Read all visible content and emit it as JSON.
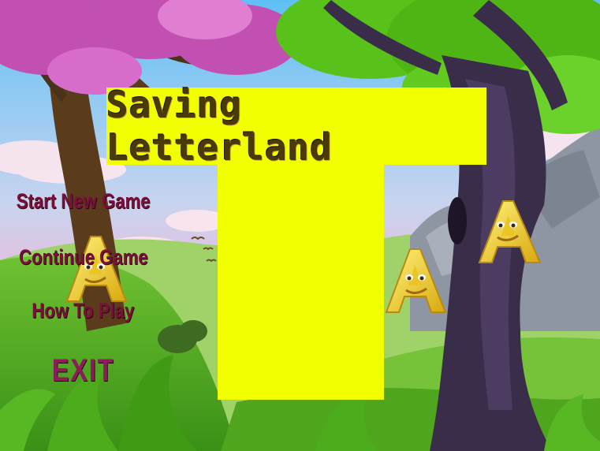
{
  "game": {
    "title": "Saving Letterland"
  },
  "menu": {
    "items": [
      {
        "label": "Start New Game"
      },
      {
        "label": "Continue Game"
      },
      {
        "label": "How To Play"
      },
      {
        "label": "EXIT"
      }
    ]
  },
  "colors": {
    "panel": "#f2ff00",
    "title_text": "#4a3a08",
    "menu_text": "#7a0f3c",
    "sky_top": "#63bff2",
    "sky_pink": "#f3b6d8",
    "grass": "#5fb82b",
    "foliage_pink": "#c24fb2",
    "foliage_green": "#58c21a",
    "trunk": "#4a3318",
    "letter_character": "#f5d92a"
  },
  "characters": [
    {
      "name": "letter-a-character",
      "letter": "A"
    },
    {
      "name": "letter-a-character",
      "letter": "A"
    },
    {
      "name": "letter-a-character",
      "letter": "A"
    }
  ]
}
